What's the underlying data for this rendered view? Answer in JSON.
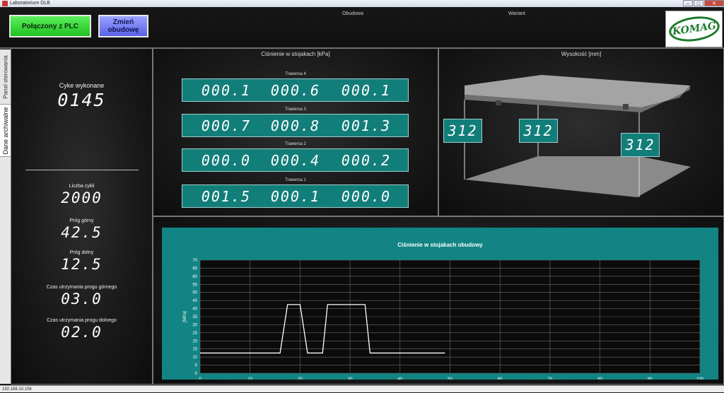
{
  "window": {
    "title": "Laboratorium DLB",
    "minimize": "–",
    "maximize": "□",
    "close": "✕"
  },
  "header": {
    "plc_button": "Połączony z PLC",
    "change_button_line1": "Zmień",
    "change_button_line2": "obudowę",
    "obudowa_label": "Obudowa",
    "wariant_label": "Wariant",
    "logo_text": "KOMAG"
  },
  "tabs": [
    {
      "label": "Panel sterowania"
    },
    {
      "label": "Dane archiwalne"
    }
  ],
  "left_panel": {
    "cycles_done_label": "Cyke wykonane",
    "cycles_done_value": "0145",
    "cycle_count_label": "Liczba cykli",
    "cycle_count_value": "2000",
    "upper_threshold_label": "Próg górny",
    "upper_threshold_value": "42.5",
    "lower_threshold_label": "Próg dolny",
    "lower_threshold_value": "12.5",
    "upper_hold_label": "Czas utrzymania progu górnego",
    "upper_hold_value": "03.0",
    "lower_hold_label": "Czas utrzymania progu dolnego",
    "lower_hold_value": "02.0"
  },
  "pressure_panel": {
    "title": "Ciśnienie w stojakach [kPa]",
    "traverses": [
      {
        "label": "Trawersa 4",
        "values": [
          "000.1",
          "000.6",
          "000.1"
        ]
      },
      {
        "label": "Trawersa 3",
        "values": [
          "000.7",
          "000.8",
          "001.3"
        ]
      },
      {
        "label": "Trawersa 2",
        "values": [
          "000.0",
          "000.4",
          "000.2"
        ]
      },
      {
        "label": "Trawersa 1",
        "values": [
          "001.5",
          "000.1",
          "000.0"
        ]
      }
    ]
  },
  "height_panel": {
    "title": "Wysokość  [mm]",
    "values": [
      "312",
      "312",
      "312"
    ]
  },
  "chart_data": {
    "type": "line",
    "title": "Ciśnienie w stojakach obudowy",
    "xlabel": "",
    "ylabel": "[MPa]",
    "xlim": [
      0,
      100
    ],
    "ylim": [
      0,
      70
    ],
    "x_ticks": [
      "0",
      "10",
      "20",
      "30",
      "40",
      "50",
      "60",
      "70",
      "80",
      "90",
      "100"
    ],
    "y_ticks": [
      "0",
      "5",
      "10",
      "15",
      "20",
      "25",
      "30",
      "35",
      "40",
      "45",
      "50",
      "55",
      "60",
      "65",
      "70"
    ],
    "grid": true,
    "line_color": "#ffffff",
    "series": [
      {
        "x": [
          0,
          16,
          17.5,
          20,
          21.5,
          24.5,
          25.5,
          33,
          34,
          49
        ],
        "y": [
          12.5,
          12.5,
          42.5,
          42.5,
          12.5,
          12.5,
          42.5,
          42.5,
          12.5,
          12.5
        ]
      }
    ]
  },
  "status_bar": {
    "text": "192.168.10.106"
  },
  "colors": {
    "teal": "#127e7a",
    "plc_green": "#2ed12e",
    "change_blue": "#6a72f0",
    "logo_green": "#1d7a2c"
  }
}
